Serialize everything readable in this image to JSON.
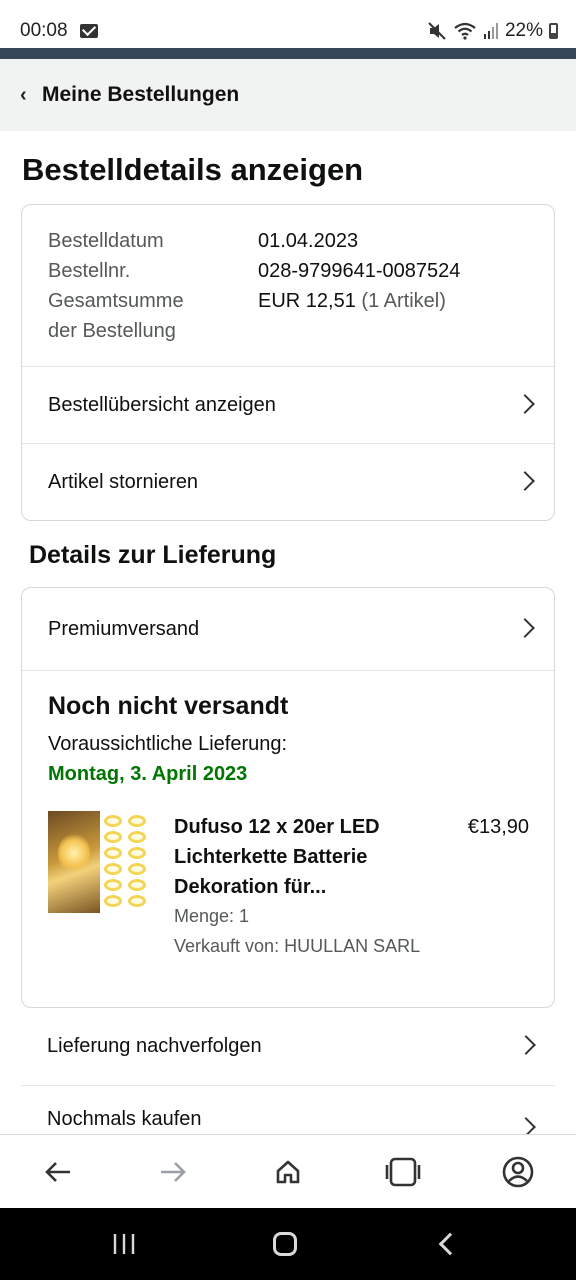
{
  "status_bar": {
    "time": "00:08",
    "battery": "22%",
    "icons": [
      "mail-icon",
      "mute-icon",
      "wifi-icon",
      "signal-icon",
      "battery-icon"
    ]
  },
  "header": {
    "back_label": "Meine Bestellungen",
    "accent_color": "#37475a"
  },
  "page": {
    "title": "Bestelldetails anzeigen"
  },
  "order_summary": {
    "date_label": "Bestelldatum",
    "date_value": "01.04.2023",
    "number_label": "Bestellnr.",
    "number_value": "028-9799641-0087524",
    "total_label_line1": "Gesamtsumme",
    "total_label_line2": "der Bestellung",
    "total_value": "EUR 12,51",
    "total_items": "(1 Artikel)",
    "rows": [
      {
        "label": "Bestellübersicht anzeigen"
      },
      {
        "label": "Artikel stornieren"
      }
    ]
  },
  "delivery": {
    "section_title": "Details zur Lieferung",
    "shipping_row": "Premiumversand",
    "status": "Noch nicht versandt",
    "expected_label": "Voraussichtliche Lieferung:",
    "expected_date": "Montag, 3. April 2023",
    "date_color": "#007600",
    "product": {
      "title": "Dufuso 12 x 20er LED Lichterkette Batterie Dekoration für...",
      "price": "€13,90",
      "quantity": "Menge: 1",
      "seller": "Verkauft von: HUULLAN SARL"
    }
  },
  "actions": [
    {
      "label": "Lieferung nachverfolgen"
    },
    {
      "label": "Nochmals kaufen"
    }
  ],
  "bottom_nav": {
    "items": [
      "back-arrow-icon",
      "forward-arrow-icon",
      "home-icon",
      "tabs-icon",
      "account-icon"
    ],
    "tabs_label": "..."
  }
}
